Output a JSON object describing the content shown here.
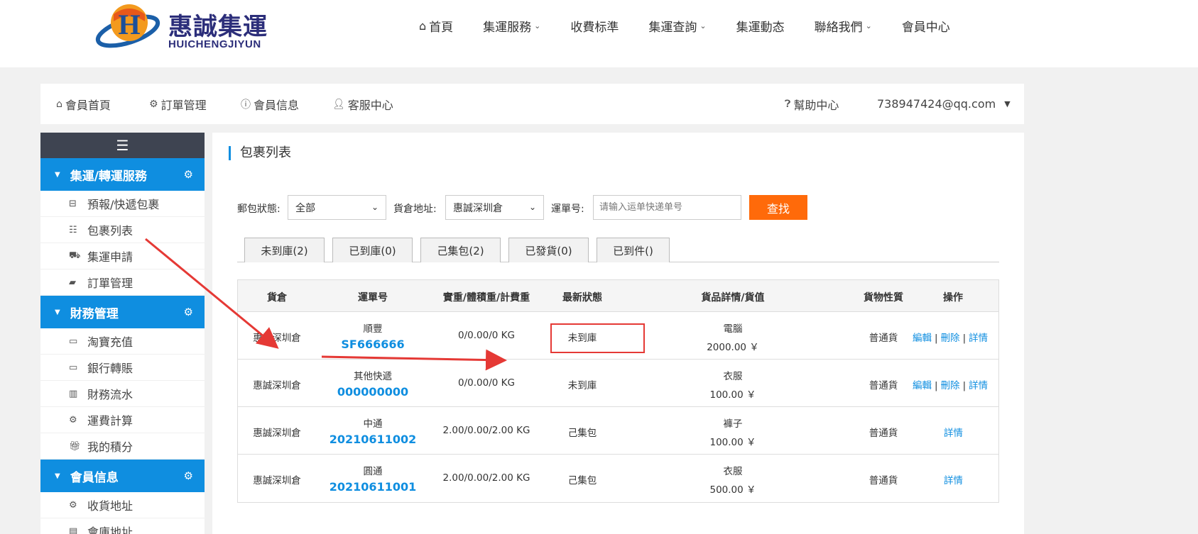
{
  "header": {
    "logo_text": "惠誠集運",
    "logo_sub": "HUICHENGJIYUN",
    "logo_mark": "H",
    "nav": [
      {
        "label": "首頁",
        "icon": "home-icon",
        "dropdown": false
      },
      {
        "label": "集運服務",
        "dropdown": true
      },
      {
        "label": "收費标準",
        "dropdown": false
      },
      {
        "label": "集運查詢",
        "dropdown": true
      },
      {
        "label": "集運動态",
        "dropdown": false
      },
      {
        "label": "聯絡我們",
        "dropdown": true
      },
      {
        "label": "會員中心",
        "dropdown": false
      }
    ]
  },
  "member_bar": {
    "items": [
      {
        "label": "會員首頁",
        "icon": "home-icon"
      },
      {
        "label": "訂單管理",
        "icon": "gear-icon"
      },
      {
        "label": "會員信息",
        "icon": "info-icon"
      },
      {
        "label": "客服中心",
        "icon": "user-icon"
      }
    ],
    "help": {
      "label": "幫助中心",
      "icon": "question-icon"
    },
    "account": "738947424@qq.com"
  },
  "sidebar": {
    "groups": [
      {
        "title": "集運/轉運服務",
        "items": [
          {
            "label": "預報/快遞包裹",
            "icon": "inbox-icon"
          },
          {
            "label": "包裹列表",
            "icon": "list-icon"
          },
          {
            "label": "集運申請",
            "icon": "truck-icon"
          },
          {
            "label": "訂單管理",
            "icon": "book-icon"
          }
        ]
      },
      {
        "title": "財務管理",
        "items": [
          {
            "label": "淘寶充值",
            "icon": "card-icon"
          },
          {
            "label": "銀行轉賬",
            "icon": "card-icon"
          },
          {
            "label": "財務流水",
            "icon": "bar-chart-icon"
          },
          {
            "label": "運費計算",
            "icon": "gears-icon"
          },
          {
            "label": "我的積分",
            "icon": "gift-icon"
          }
        ]
      },
      {
        "title": "會員信息",
        "items": [
          {
            "label": "收貨地址",
            "icon": "gears-icon"
          },
          {
            "label": "會庫地址",
            "icon": "doc-icon"
          }
        ]
      }
    ]
  },
  "main": {
    "title": "包裹列表",
    "filters": {
      "status_label": "郵包狀態:",
      "status_value": "全部",
      "warehouse_label": "貨倉地址:",
      "warehouse_value": "惠誠深圳倉",
      "tracking_label": "運單号:",
      "tracking_placeholder": "请输入运单快递单号",
      "search_button": "查找"
    },
    "tabs": [
      "未到庫(2)",
      "已到庫(0)",
      "己集包(2)",
      "已發貨(0)",
      "已到件()"
    ],
    "table": {
      "headers": [
        "貨倉",
        "運單号",
        "實重/體積重/計費重",
        "最新狀態",
        "貨品詳情/貨值",
        "貨物性質",
        "操作"
      ],
      "rows": [
        {
          "warehouse": "惠誠深圳倉",
          "carrier": "順豐",
          "tracking": "SF666666",
          "weight": "0/0.00/0 KG",
          "status": "未到庫",
          "goods": "電腦",
          "value": "2000.00 ￥",
          "nature": "普通貨",
          "actions": [
            "編輯",
            "刪除",
            "詳情"
          ]
        },
        {
          "warehouse": "惠誠深圳倉",
          "carrier": "其他快遞",
          "tracking": "000000000",
          "weight": "0/0.00/0 KG",
          "status": "未到庫",
          "goods": "衣服",
          "value": "100.00 ￥",
          "nature": "普通貨",
          "actions": [
            "編輯",
            "刪除",
            "詳情"
          ]
        },
        {
          "warehouse": "惠誠深圳倉",
          "carrier": "中通",
          "tracking": "20210611002",
          "weight": "2.00/0.00/2.00 KG",
          "status": "己集包",
          "goods": "褲子",
          "value": "100.00 ￥",
          "nature": "普通貨",
          "actions": [
            "詳情"
          ]
        },
        {
          "warehouse": "惠誠深圳倉",
          "carrier": "圓通",
          "tracking": "20210611001",
          "weight": "2.00/0.00/2.00 KG",
          "status": "己集包",
          "goods": "衣服",
          "value": "500.00 ￥",
          "nature": "普通貨",
          "actions": [
            "詳情"
          ]
        }
      ]
    }
  },
  "colors": {
    "accent": "#0f8ee0",
    "button": "#ff6a0a",
    "annotation": "#e53935",
    "sidebar_toggle": "#3e4451"
  }
}
